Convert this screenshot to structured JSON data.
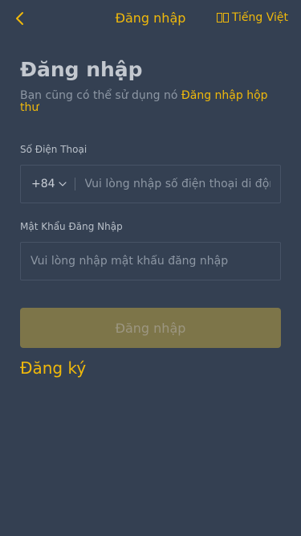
{
  "header": {
    "title": "Đăng nhập",
    "language": "Tiếng Việt",
    "back_icon": "chevron-left-icon",
    "accent_color": "#f0b90b"
  },
  "main": {
    "heading": "Đăng nhập",
    "subtitle_text": "Bạn cũng có thể sử dụng nó ",
    "subtitle_link": "Đăng nhập hộp thư"
  },
  "phone": {
    "label": "Số Điện Thoại",
    "country_code": "+84",
    "placeholder": "Vui lòng nhập số điện thoại di động"
  },
  "password": {
    "label": "Mật Khẩu Đăng Nhập",
    "placeholder": "Vui lòng nhập mật khẩu đăng nhập"
  },
  "actions": {
    "submit_label": "Đăng nhập",
    "register_label": "Đăng ký"
  },
  "colors": {
    "background": "#344052",
    "button_disabled": "#7d7549"
  }
}
